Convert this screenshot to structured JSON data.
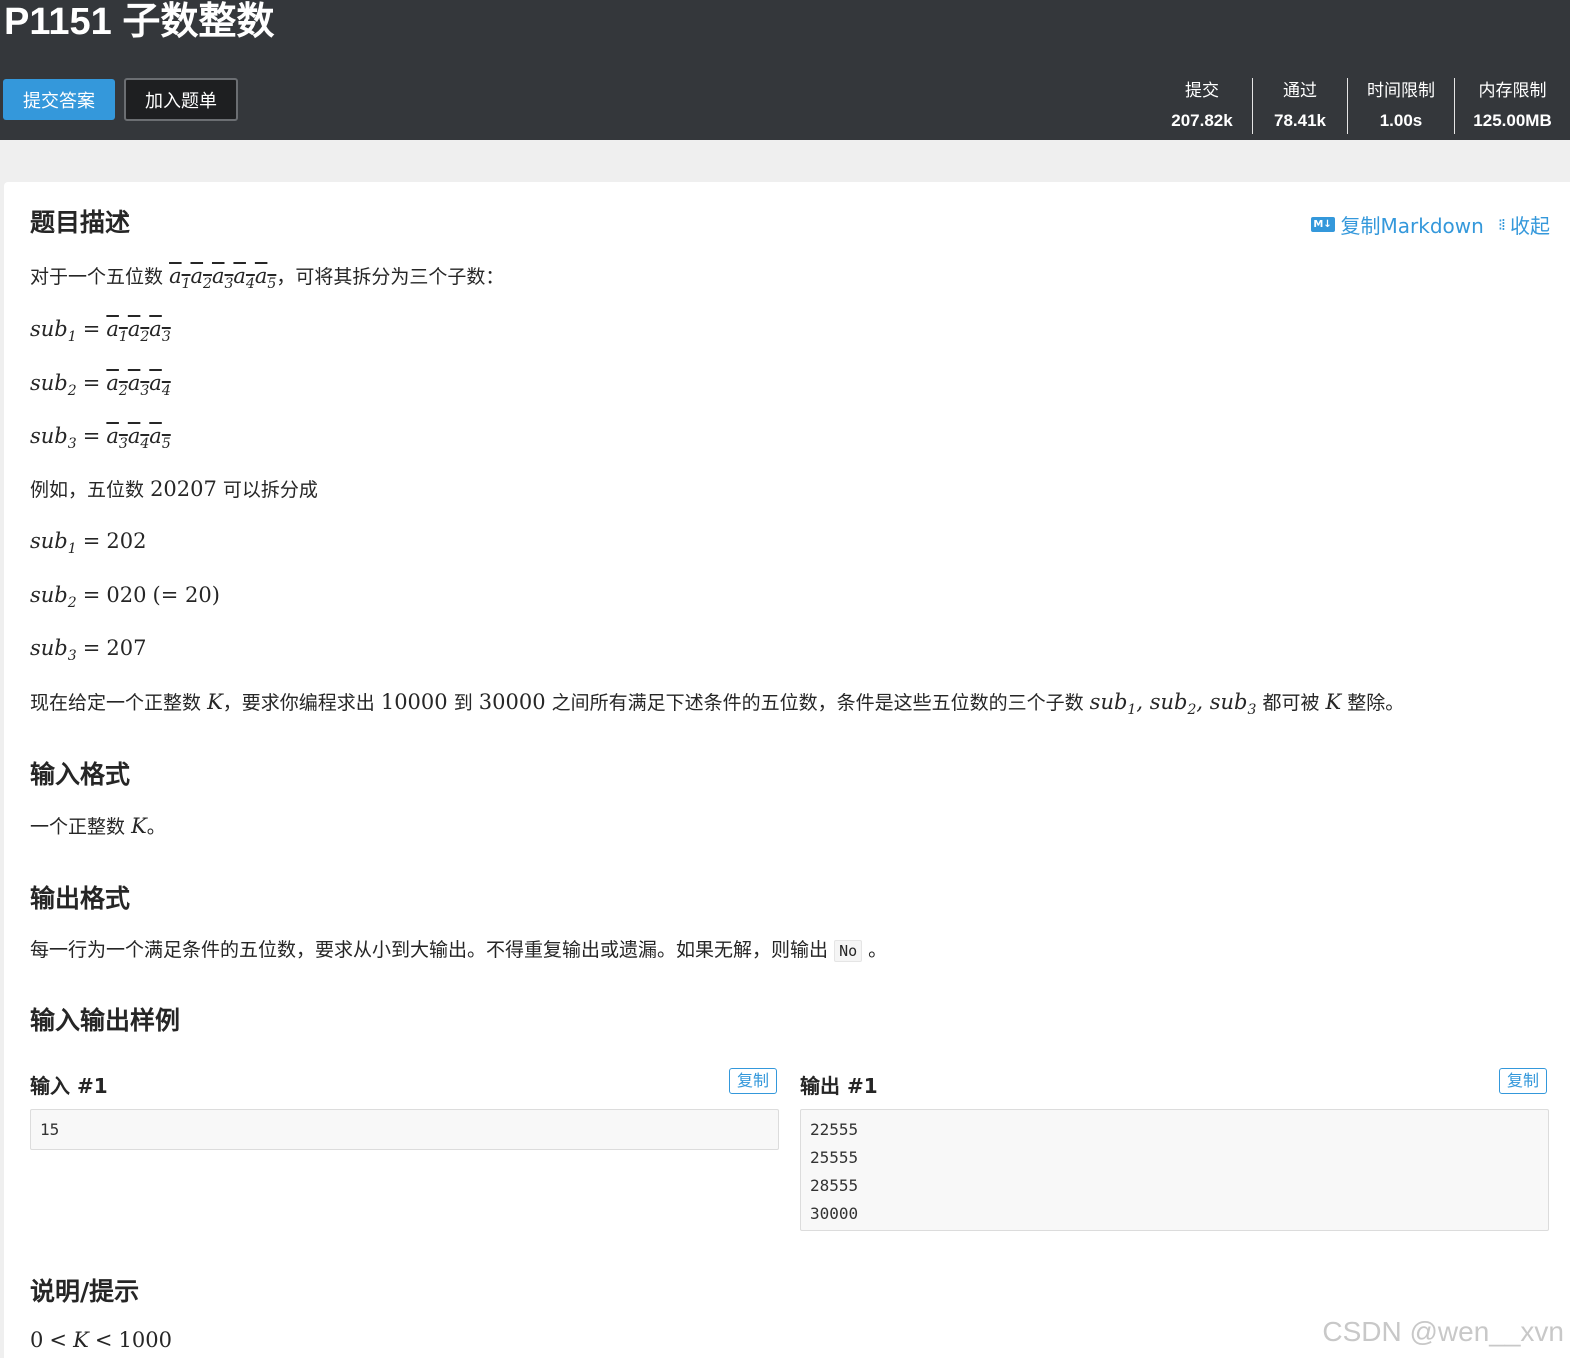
{
  "header": {
    "title": "P1151 子数整数",
    "submit_label": "提交答案",
    "add_label": "加入题单",
    "stats": [
      {
        "label": "提交",
        "value": "207.82k"
      },
      {
        "label": "通过",
        "value": "78.41k"
      },
      {
        "label": "时间限制",
        "value": "1.00s"
      },
      {
        "label": "内存限制",
        "value": "125.00MB"
      }
    ]
  },
  "toolbar": {
    "md_icon_text": "M↓",
    "copy_markdown": "复制Markdown",
    "collapse": "收起"
  },
  "description": {
    "title": "题目描述",
    "intro_prefix": "对于一个五位数",
    "intro_suffix": "，可将其拆分为三个子数：",
    "example_prefix": "例如，五位数",
    "example_number": "20207",
    "example_suffix": "可以拆分成",
    "sub_values": [
      "202",
      "020",
      "(= 20)",
      "207"
    ],
    "task_parts": [
      "现在给定一个正整数",
      "，要求你编程求出",
      "10000",
      "到",
      "30000",
      "之间所有满足下述条件的五位数，条件是这些五位数的三个子数",
      "都可被",
      "整除。"
    ]
  },
  "input_format": {
    "title": "输入格式",
    "text": "一个正整数",
    "suffix": "。"
  },
  "output_format": {
    "title": "输出格式",
    "text": "每一行为一个满足条件的五位数，要求从小到大输出。不得重复输出或遗漏。如果无解，则输出",
    "code": "No",
    "suffix": "。"
  },
  "samples": {
    "title": "输入输出样例",
    "input_label": "输入 #1",
    "output_label": "输出 #1",
    "copy_label": "复制",
    "input_lines": [
      "15"
    ],
    "output_lines": [
      "22555",
      "25555",
      "28555",
      "30000"
    ]
  },
  "hint": {
    "title": "说明/提示",
    "lower": "0",
    "upper": "1000"
  },
  "watermark": "CSDN @wen__xvn"
}
